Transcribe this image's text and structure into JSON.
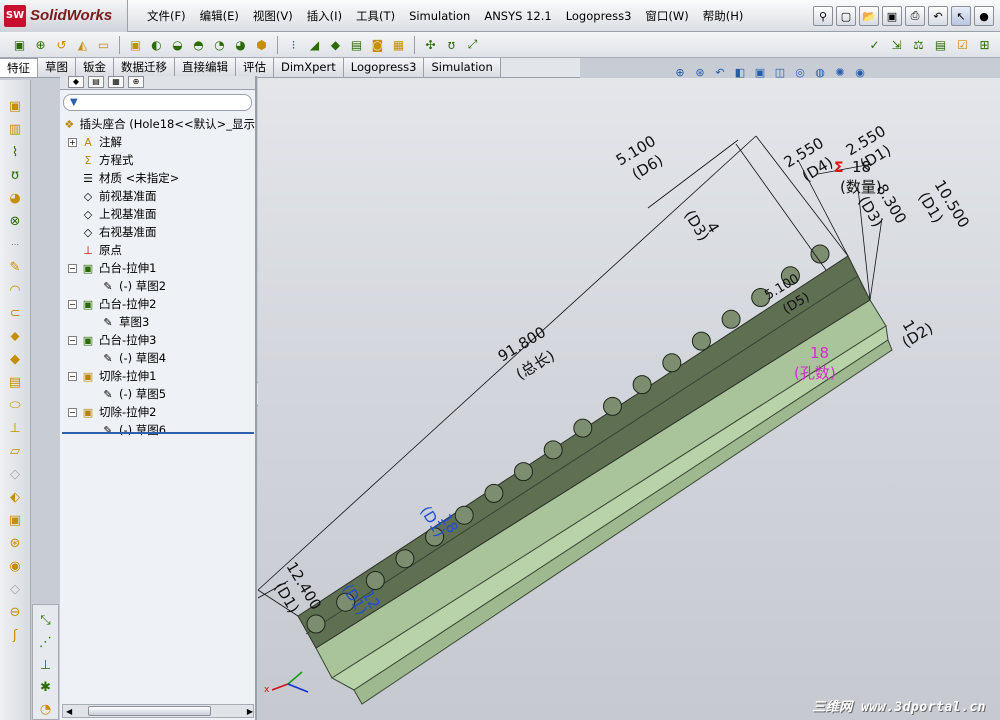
{
  "app": {
    "logo_badge": "SW",
    "name": "SolidWorks"
  },
  "menu": [
    "文件(F)",
    "编辑(E)",
    "视图(V)",
    "插入(I)",
    "工具(T)",
    "Simulation",
    "ANSYS 12.1",
    "Logopress3",
    "窗口(W)",
    "帮助(H)"
  ],
  "tabs": [
    "特征",
    "草图",
    "钣金",
    "数据迁移",
    "直接编辑",
    "评估",
    "DimXpert",
    "Logopress3",
    "Simulation"
  ],
  "active_tab": "特征",
  "tree": {
    "root": "插头座合  (Hole18<<默认>_显示",
    "items": [
      {
        "label": "注解",
        "icon": "annotation-icon",
        "expand": "+"
      },
      {
        "label": "方程式",
        "icon": "equation-icon",
        "expand": ""
      },
      {
        "label": "材质 <未指定>",
        "icon": "material-icon",
        "expand": ""
      },
      {
        "label": "前视基准面",
        "icon": "plane-icon",
        "expand": ""
      },
      {
        "label": "上视基准面",
        "icon": "plane-icon",
        "expand": ""
      },
      {
        "label": "右视基准面",
        "icon": "plane-icon",
        "expand": ""
      },
      {
        "label": "原点",
        "icon": "origin-icon",
        "expand": ""
      },
      {
        "label": "凸台-拉伸1",
        "icon": "extrude-icon",
        "expand": "−"
      },
      {
        "label": "(-) 草图2",
        "icon": "sketch-icon",
        "expand": "",
        "child": true
      },
      {
        "label": "凸台-拉伸2",
        "icon": "extrude-icon",
        "expand": "−"
      },
      {
        "label": "草图3",
        "icon": "sketch-icon",
        "expand": "",
        "child": true
      },
      {
        "label": "凸台-拉伸3",
        "icon": "extrude-icon",
        "expand": "−"
      },
      {
        "label": "(-) 草图4",
        "icon": "sketch-icon",
        "expand": "",
        "child": true
      },
      {
        "label": "切除-拉伸1",
        "icon": "cut-icon",
        "expand": "−"
      },
      {
        "label": "(-) 草图5",
        "icon": "sketch-icon",
        "expand": "",
        "child": true
      },
      {
        "label": "切除-拉伸2",
        "icon": "cut-icon",
        "expand": "−"
      },
      {
        "label": "(-) 草图6",
        "icon": "sketch-icon",
        "expand": "",
        "child": true
      }
    ]
  },
  "dimensions": {
    "d6": "5.100",
    "d6_name": "(D6)",
    "d4": "2.550",
    "d4_name": "(D4)",
    "d1_top": "2.550",
    "d1_top_name": "(D1)",
    "count_val": "18",
    "count_label": "(数量)",
    "d3_top": "4",
    "d3_top_name": "(D3)",
    "d3_right": "8.300",
    "d3_right_name": "(D3)",
    "d1_right": "10.500",
    "d1_right_name": "(D1)",
    "total": "91.800",
    "total_label": "(总长)",
    "d2": "1",
    "d2_name": "(D2)",
    "holes": "18",
    "holes_label": "(孔数)",
    "d5": "5.100",
    "d5_name": "(D5)",
    "blue1": "18",
    "blue1_name": "(D1)",
    "blue2": "12",
    "blue2_name": "(D1)",
    "left": "12.400",
    "left_name": "(D1)",
    "sum_symbol": "Σ"
  },
  "colors": {
    "accent": "#2c5fb0",
    "part_top": "#5f6f52",
    "part_side": "#a9c49a",
    "dim_black": "#111111",
    "dim_blue": "#1f4fd0",
    "dim_magenta": "#d030d0",
    "sum_red": "#e01010"
  },
  "watermark": "三维网 www.3dportal.cn"
}
